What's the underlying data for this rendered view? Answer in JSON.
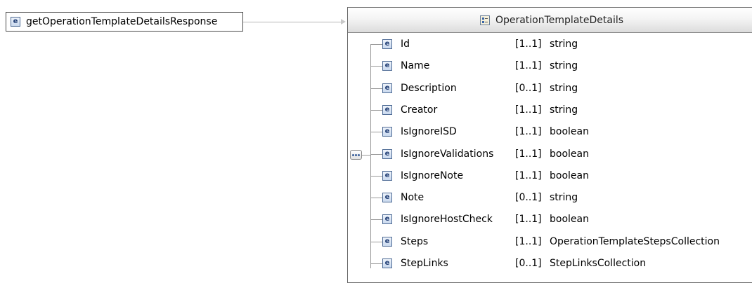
{
  "root_element": {
    "icon": "element-icon",
    "icon_glyph": "e",
    "label": "getOperationTemplateDetailsResponse"
  },
  "type_box": {
    "icon": "complex-type-icon",
    "title": "OperationTemplateDetails"
  },
  "compositor": {
    "icon": "sequence-icon"
  },
  "children": [
    {
      "icon_glyph": "e",
      "name": "Id",
      "cardinality": "[1..1]",
      "type": "string"
    },
    {
      "icon_glyph": "e",
      "name": "Name",
      "cardinality": "[1..1]",
      "type": "string"
    },
    {
      "icon_glyph": "e",
      "name": "Description",
      "cardinality": "[0..1]",
      "type": "string"
    },
    {
      "icon_glyph": "e",
      "name": "Creator",
      "cardinality": "[1..1]",
      "type": "string"
    },
    {
      "icon_glyph": "e",
      "name": "IsIgnoreISD",
      "cardinality": "[1..1]",
      "type": "boolean"
    },
    {
      "icon_glyph": "e",
      "name": "IsIgnoreValidations",
      "cardinality": "[1..1]",
      "type": "boolean"
    },
    {
      "icon_glyph": "e",
      "name": "IsIgnoreNote",
      "cardinality": "[1..1]",
      "type": "boolean"
    },
    {
      "icon_glyph": "e",
      "name": "Note",
      "cardinality": "[0..1]",
      "type": "string"
    },
    {
      "icon_glyph": "e",
      "name": "IsIgnoreHostCheck",
      "cardinality": "[1..1]",
      "type": "boolean"
    },
    {
      "icon_glyph": "e",
      "name": "Steps",
      "cardinality": "[1..1]",
      "type": "OperationTemplateStepsCollection"
    },
    {
      "icon_glyph": "e",
      "name": "StepLinks",
      "cardinality": "[0..1]",
      "type": "StepLinksCollection"
    }
  ]
}
